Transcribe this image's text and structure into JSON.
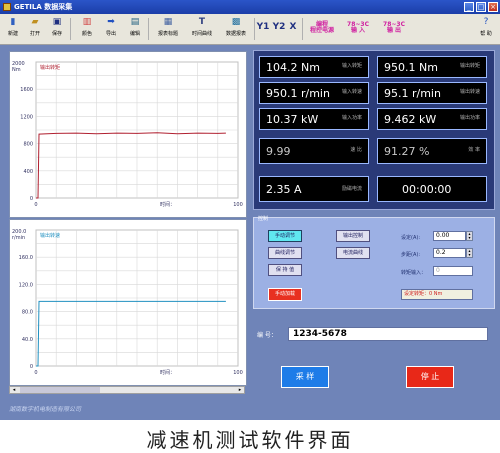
{
  "window": {
    "title": "GETILA 数据采集"
  },
  "toolbar": {
    "buttons": [
      {
        "label": "新建",
        "icon": "new-file-icon"
      },
      {
        "label": "打开",
        "icon": "open-folder-icon"
      },
      {
        "label": "保存",
        "icon": "save-icon"
      },
      {
        "label": "颜色",
        "icon": "color-icon"
      },
      {
        "label": "导出",
        "icon": "export-icon"
      },
      {
        "label": "编辑",
        "icon": "edit-icon"
      },
      {
        "label": "报表标题",
        "icon": "report-title-icon"
      },
      {
        "label": "时间曲线",
        "icon": "time-curve-icon"
      },
      {
        "label": "数据报表",
        "icon": "data-report-icon"
      }
    ],
    "y1": "Y1",
    "y2": "Y2",
    "x": "X",
    "mode_btn": "编程\n程控电源",
    "in_btn": "78~3C\n输 入",
    "out_btn": "78~3C\n输 出",
    "help": "帮 助"
  },
  "chart_data": [
    {
      "type": "line",
      "title": "输出转矩",
      "unit": "2000\nNm",
      "xlabel": "时间：",
      "x_ticks": [
        "0",
        "100"
      ],
      "y_ticks": [
        "0",
        "400",
        "800",
        "1200",
        "1600",
        "2000"
      ],
      "ylim": [
        0,
        2000
      ],
      "xlim": [
        0,
        100
      ],
      "color": "#b02030",
      "series": [
        {
          "x": [
            0,
            1,
            1.5,
            10,
            20,
            30,
            40,
            50,
            60,
            70,
            80,
            90,
            94
          ],
          "y": [
            0,
            0,
            940,
            950,
            955,
            945,
            955,
            950,
            960,
            945,
            955,
            950,
            955
          ]
        }
      ]
    },
    {
      "type": "line",
      "title": "输出转速",
      "unit": "200.0\nr/min",
      "xlabel": "时间：",
      "x_ticks": [
        "0",
        "100"
      ],
      "y_ticks": [
        "0",
        "40.0",
        "80.0",
        "120.0",
        "160.0",
        "200.0"
      ],
      "ylim": [
        0,
        200
      ],
      "xlim": [
        0,
        100
      ],
      "color": "#2090c0",
      "series": [
        {
          "x": [
            0,
            1,
            1.5,
            94
          ],
          "y": [
            0,
            0,
            95,
            95
          ]
        }
      ]
    }
  ],
  "readouts": [
    {
      "value": "104.2 Nm",
      "label": "输入转矩"
    },
    {
      "value": "950.1 Nm",
      "label": "输出转矩"
    },
    {
      "value": "950.1 r/min",
      "label": "输入转速"
    },
    {
      "value": "95.1 r/min",
      "label": "输出转速"
    },
    {
      "value": "10.37 kW",
      "label": "输入功率"
    },
    {
      "value": "9.462 kW",
      "label": "输出功率"
    },
    {
      "value": "9.99",
      "label": "速 比"
    },
    {
      "value": "91.27 %",
      "label": "效 率"
    },
    {
      "value": "2.35 A",
      "label": "励磁电流"
    },
    {
      "value": "00:00:00",
      "label": ""
    }
  ],
  "control": {
    "title": "控制",
    "btn_manual": "手动调节",
    "btn_output_control": "输出控制",
    "btn_curve": "曲线调节",
    "btn_current_curve": "电流曲线",
    "btn_hold": "保 持 值",
    "btn_load": "手动加载",
    "label_set": "设定(A):",
    "set_value": "0.00",
    "label_step": "步距(A):",
    "step_value": "0.2",
    "label_torque": "转矩输入：",
    "torque_value": "0",
    "set_torque": "设定转矩：0 Nm"
  },
  "serial": {
    "label": "编 号：",
    "value": "1234-5678"
  },
  "actions": {
    "start": "采 样",
    "stop": "停 止"
  },
  "company": "湖南数字机电制造有限公司",
  "caption": "减速机测试软件界面"
}
